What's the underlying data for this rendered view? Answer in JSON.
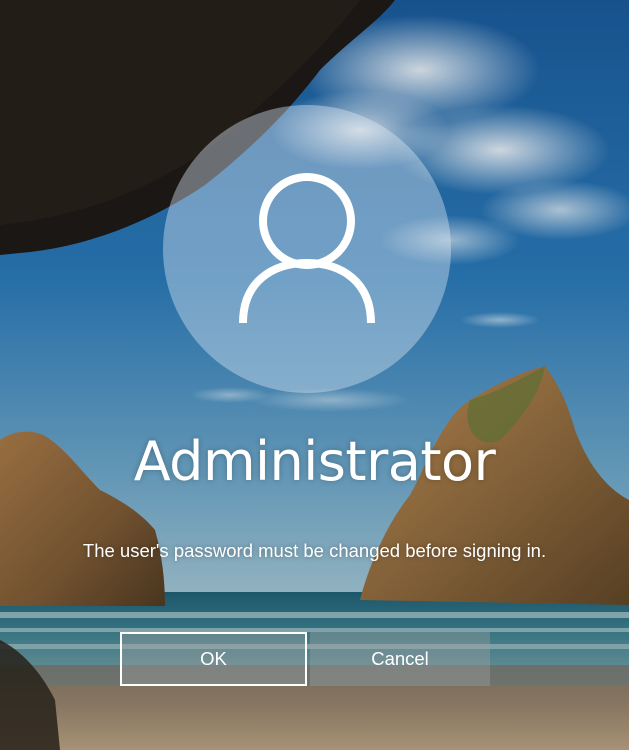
{
  "signin": {
    "username": "Administrator",
    "message": "The user's password must be changed before signing in."
  },
  "buttons": {
    "ok_label": "OK",
    "cancel_label": "Cancel"
  },
  "icons": {
    "avatar": "user-silhouette-icon"
  },
  "colors": {
    "text": "#ffffff",
    "button_fill": "rgba(160,160,160,0.38)",
    "focus_border": "#ffffff"
  }
}
